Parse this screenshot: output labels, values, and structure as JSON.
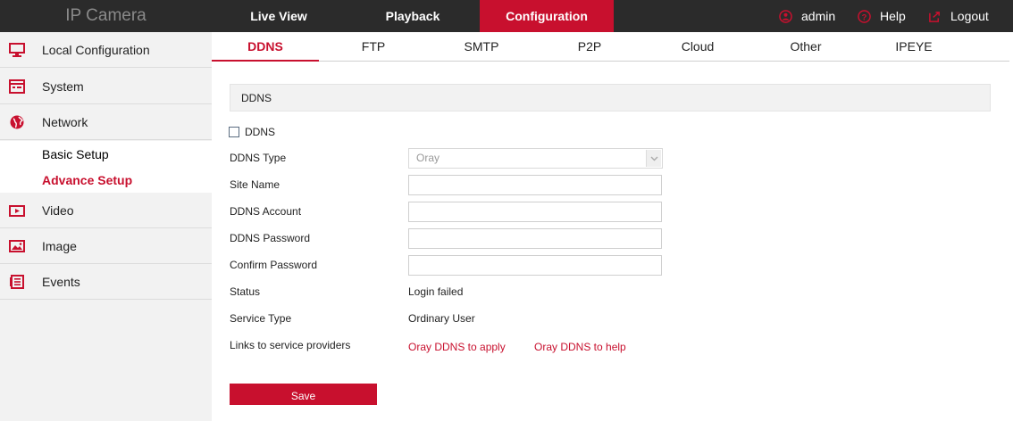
{
  "brand": "IP Camera",
  "nav": {
    "live_view": "Live View",
    "playback": "Playback",
    "configuration": "Configuration"
  },
  "header_right": {
    "user": "admin",
    "help": "Help",
    "logout": "Logout"
  },
  "sidebar": {
    "items": [
      {
        "label": "Local Configuration",
        "icon": "monitor-icon"
      },
      {
        "label": "System",
        "icon": "system-window-icon"
      },
      {
        "label": "Network",
        "icon": "globe-icon"
      },
      {
        "label": "Video",
        "icon": "video-icon"
      },
      {
        "label": "Image",
        "icon": "image-icon"
      },
      {
        "label": "Events",
        "icon": "events-list-icon"
      }
    ],
    "sub_items": [
      {
        "label": "Basic Setup",
        "active": false
      },
      {
        "label": "Advance Setup",
        "active": true
      }
    ]
  },
  "tabs": [
    "DDNS",
    "FTP",
    "SMTP",
    "P2P",
    "Cloud",
    "Other",
    "IPEYE"
  ],
  "section_title": "DDNS",
  "form": {
    "enable_label": "DDNS",
    "enable_checked": false,
    "ddns_type_label": "DDNS Type",
    "ddns_type_value": "Oray",
    "site_name_label": "Site Name",
    "site_name_value": "",
    "account_label": "DDNS Account",
    "account_value": "",
    "password_label": "DDNS Password",
    "password_value": "",
    "confirm_label": "Confirm Password",
    "confirm_value": "",
    "status_label": "Status",
    "status_value": "Login failed",
    "service_type_label": "Service Type",
    "service_type_value": "Ordinary User",
    "links_label": "Links to service providers",
    "link_apply": "Oray DDNS to apply",
    "link_help": "Oray DDNS to help",
    "save_label": "Save"
  },
  "colors": {
    "accent": "#c8102e",
    "topbar": "#2b2b2b",
    "sidebar_bg": "#f2f2f2"
  }
}
